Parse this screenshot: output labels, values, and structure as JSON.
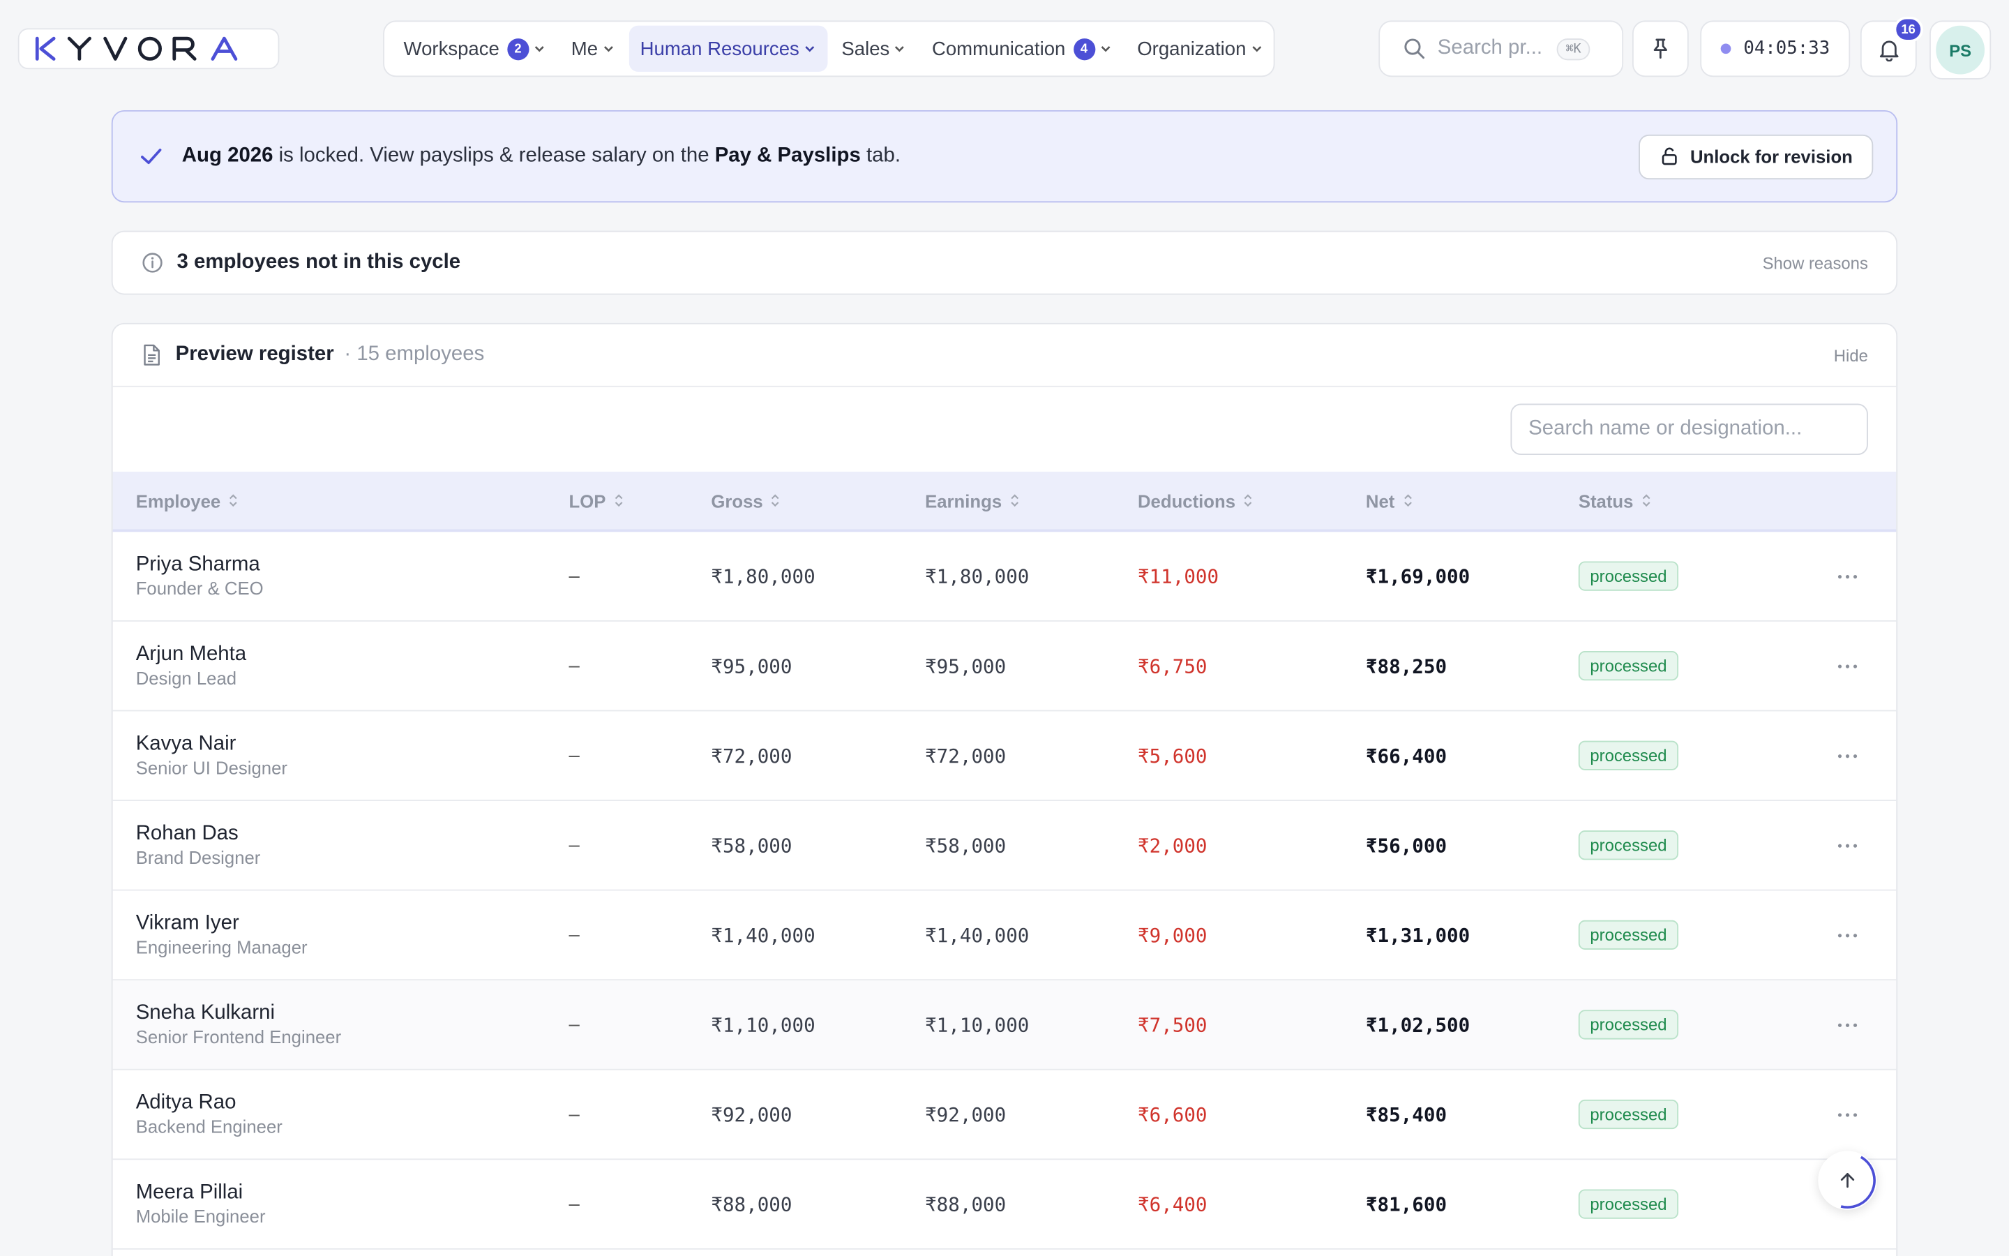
{
  "header": {
    "logo_text": "KYVORA",
    "nav": [
      {
        "label": "Workspace",
        "badge": "2",
        "active": false
      },
      {
        "label": "Me",
        "badge": "",
        "active": false
      },
      {
        "label": "Human Resources",
        "badge": "",
        "active": true
      },
      {
        "label": "Sales",
        "badge": "",
        "active": false
      },
      {
        "label": "Communication",
        "badge": "4",
        "active": false
      },
      {
        "label": "Organization",
        "badge": "",
        "active": false
      }
    ],
    "search_placeholder": "Search pr...",
    "search_shortcut": "⌘K",
    "clock": "04:05:33",
    "notifications_count": "16",
    "avatar_initials": "PS",
    "accent_color": "#4c4fd6"
  },
  "banner": {
    "period": "Aug 2026",
    "text_mid": " is locked. View payslips & release salary on the ",
    "tab_name": "Pay & Payslips",
    "text_end": " tab.",
    "button_label": "Unlock for revision"
  },
  "notice": {
    "text": "3 employees not in this cycle",
    "link": "Show reasons"
  },
  "register": {
    "title": "Preview register",
    "subtitle": "· 15 employees",
    "hide_label": "Hide",
    "filter_placeholder": "Search name or designation...",
    "columns": [
      "Employee",
      "LOP",
      "Gross",
      "Earnings",
      "Deductions",
      "Net",
      "Status"
    ],
    "rows": [
      {
        "name": "Priya Sharma",
        "designation": "Founder & CEO",
        "lop": "–",
        "gross": "₹1,80,000",
        "earnings": "₹1,80,000",
        "deductions": "₹11,000",
        "net": "₹1,69,000",
        "status": "processed"
      },
      {
        "name": "Arjun Mehta",
        "designation": "Design Lead",
        "lop": "–",
        "gross": "₹95,000",
        "earnings": "₹95,000",
        "deductions": "₹6,750",
        "net": "₹88,250",
        "status": "processed"
      },
      {
        "name": "Kavya Nair",
        "designation": "Senior UI Designer",
        "lop": "–",
        "gross": "₹72,000",
        "earnings": "₹72,000",
        "deductions": "₹5,600",
        "net": "₹66,400",
        "status": "processed"
      },
      {
        "name": "Rohan Das",
        "designation": "Brand Designer",
        "lop": "–",
        "gross": "₹58,000",
        "earnings": "₹58,000",
        "deductions": "₹2,000",
        "net": "₹56,000",
        "status": "processed"
      },
      {
        "name": "Vikram Iyer",
        "designation": "Engineering Manager",
        "lop": "–",
        "gross": "₹1,40,000",
        "earnings": "₹1,40,000",
        "deductions": "₹9,000",
        "net": "₹1,31,000",
        "status": "processed"
      },
      {
        "name": "Sneha Kulkarni",
        "designation": "Senior Frontend Engineer",
        "lop": "–",
        "gross": "₹1,10,000",
        "earnings": "₹1,10,000",
        "deductions": "₹7,500",
        "net": "₹1,02,500",
        "status": "processed"
      },
      {
        "name": "Aditya Rao",
        "designation": "Backend Engineer",
        "lop": "–",
        "gross": "₹92,000",
        "earnings": "₹92,000",
        "deductions": "₹6,600",
        "net": "₹85,400",
        "status": "processed"
      },
      {
        "name": "Meera Pillai",
        "designation": "Mobile Engineer",
        "lop": "–",
        "gross": "₹88,000",
        "earnings": "₹88,000",
        "deductions": "₹6,400",
        "net": "₹81,600",
        "status": "processed"
      }
    ]
  }
}
